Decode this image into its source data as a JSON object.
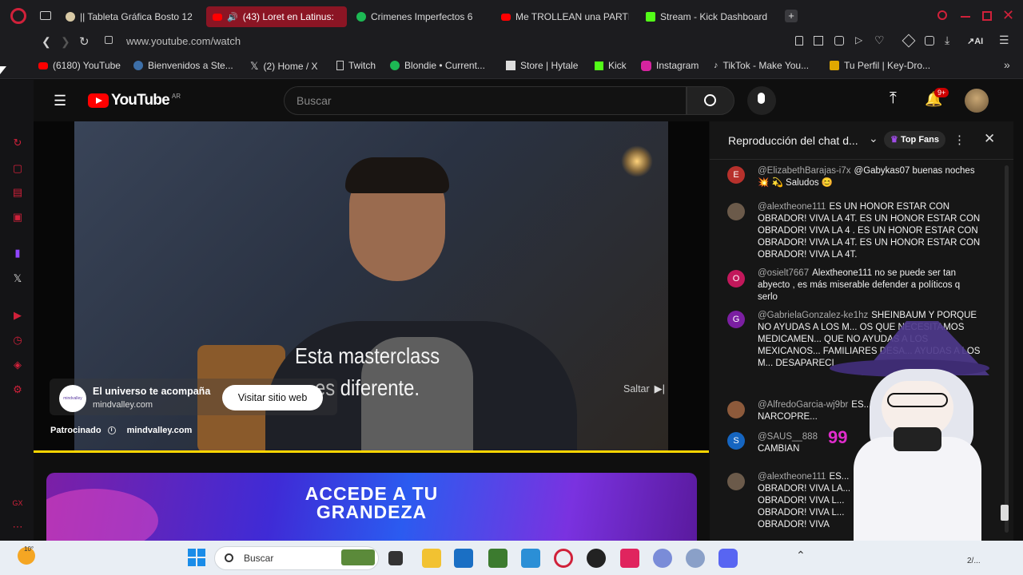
{
  "tabs": [
    {
      "label": "|| Tableta Gráfica Bosto 12",
      "active": false
    },
    {
      "label": "(43) Loret en Latinus:",
      "active": true
    },
    {
      "label": "Crimenes Imperfectos 6",
      "active": false
    },
    {
      "label": "Me TROLLEAN una PARTI",
      "active": false
    },
    {
      "label": "Stream - Kick Dashboard",
      "active": false
    }
  ],
  "address": {
    "url": "www.youtube.com/watch",
    "ai_label": "AI"
  },
  "bookmarks": [
    {
      "label": "(6180) YouTube"
    },
    {
      "label": "Bienvenidos a Ste..."
    },
    {
      "label": "(2) Home / X"
    },
    {
      "label": "Twitch"
    },
    {
      "label": "Blondie • Current..."
    },
    {
      "label": "Store | Hytale"
    },
    {
      "label": "Kick"
    },
    {
      "label": "Instagram"
    },
    {
      "label": "TikTok - Make You..."
    },
    {
      "label": "Tu Perfil | Key-Dro..."
    }
  ],
  "youtube": {
    "logo_text": "YouTube",
    "region": "AR",
    "search_placeholder": "Buscar",
    "notifications_badge": "9+"
  },
  "video": {
    "caption_line1": "Esta masterclass",
    "caption_line2": "es diferente.",
    "ad_title": "El universo te acompaña",
    "ad_domain": "mindvalley.com",
    "ad_logo_text": "mindvalley",
    "visit_button": "Visitar sitio web",
    "skip_label": "Saltar",
    "sponsored_label": "Patrocinado",
    "sponsor_domain": "mindvalley.com",
    "banner_line1": "ACCEDE A TU",
    "banner_line2": "GRANDEZA"
  },
  "chat": {
    "title": "Reproducción del chat d...",
    "top_fans_label": "Top Fans",
    "messages": [
      {
        "avatar": "E",
        "color": "#b7312c",
        "author": "@ElizabethBarajas-i7x",
        "text": "@Gabykas07 buenas noches 💥 💫 Saludos 😊"
      },
      {
        "avatar": "",
        "color": "#6b5a4a",
        "author": "@alextheone111",
        "text": "ES UN HONOR ESTAR CON OBRADOR! VIVA LA 4T. ES UN HONOR ESTAR CON OBRADOR! VIVA LA 4 . ES UN HONOR ESTAR CON OBRADOR! VIVA LA 4T. ES UN HONOR ESTAR CON OBRADOR! VIVA LA 4T."
      },
      {
        "avatar": "O",
        "color": "#c2185b",
        "author": "@osielt7667",
        "text": "Alextheone111 no se puede ser tan abyecto , es más miserable defender a políticos q serlo"
      },
      {
        "avatar": "G",
        "color": "#7b1fa2",
        "author": "@GabrielaGonzalez-ke1hz",
        "text": "SHEINBAUM Y PORQUE NO AYUDAS A LOS M... OS QUE NECESITAMOS MEDICAMEN... QUE NO AYUDAS A LOS MEXICANOS... FAMILIARES DESA... AYUDAS A LOS M... DESAPARECI"
      },
      {
        "avatar": "",
        "color": "#8d5a3b",
        "author": "@AlfredoGarcia-wj9br",
        "text": "ES... AR CON KKDOR NARCOPRE..."
      },
      {
        "avatar": "S",
        "color": "#1565c0",
        "author": "@SAUS__888",
        "text": "CAMBIAN"
      },
      {
        "avatar": "",
        "color": "#6b5a4a",
        "author": "@alextheone111",
        "text": "ES... OBRADOR! VIVA LA... OBRADOR! VIVA L... OBRADOR! VIVA L... OBRADOR! VIVA"
      }
    ]
  },
  "taskbar": {
    "weather_temp": "10°",
    "search_placeholder": "Buscar",
    "tray_text": "2/..."
  },
  "colors": {
    "accent_red": "#d0213a",
    "youtube_red": "#ff0000",
    "yellow_progress": "#ffd600"
  }
}
